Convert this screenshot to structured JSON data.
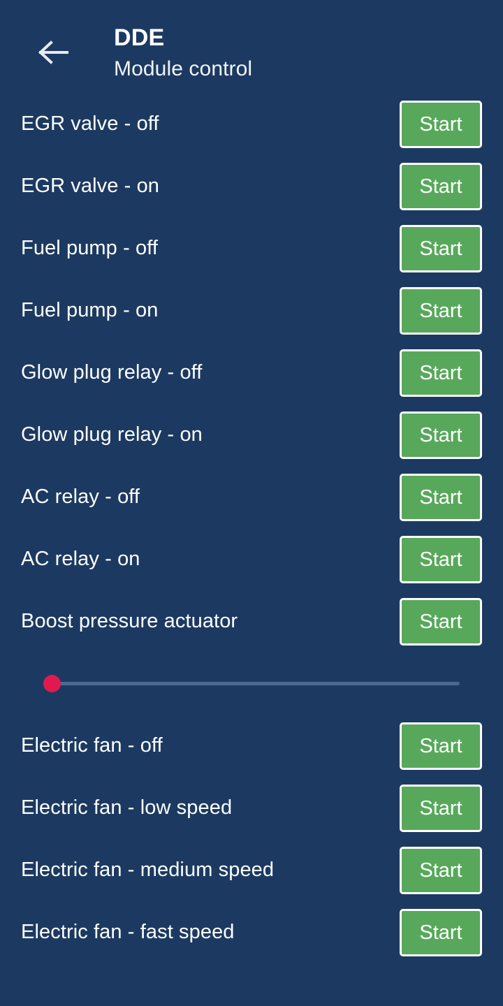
{
  "colors": {
    "background": "#1c3a61",
    "button_fill": "#58a85b",
    "button_border": "#ffffff",
    "text": "#ffffff",
    "slider_thumb": "#e01a4f",
    "slider_track": "#4a6a94"
  },
  "header": {
    "back_icon": "arrow-left-icon",
    "title": "DDE",
    "subtitle": "Module control"
  },
  "list": {
    "button_label": "Start",
    "items": [
      {
        "label": "EGR valve - off",
        "action": "Start"
      },
      {
        "label": "EGR valve - on",
        "action": "Start"
      },
      {
        "label": "Fuel pump - off",
        "action": "Start"
      },
      {
        "label": "Fuel pump - on",
        "action": "Start"
      },
      {
        "label": "Glow plug relay - off",
        "action": "Start"
      },
      {
        "label": "Glow plug relay - on",
        "action": "Start"
      },
      {
        "label": "AC relay - off",
        "action": "Start"
      },
      {
        "label": "AC relay - on",
        "action": "Start"
      },
      {
        "label": "Boost pressure actuator",
        "action": "Start"
      }
    ],
    "items_after_slider": [
      {
        "label": "Electric fan - off",
        "action": "Start"
      },
      {
        "label": "Electric fan - low speed",
        "action": "Start"
      },
      {
        "label": "Electric fan - medium speed",
        "action": "Start"
      },
      {
        "label": "Electric fan - fast speed",
        "action": "Start"
      }
    ]
  },
  "slider": {
    "name": "boost-pressure-slider",
    "value": 0,
    "min": 0,
    "max": 100,
    "percent": 0
  }
}
